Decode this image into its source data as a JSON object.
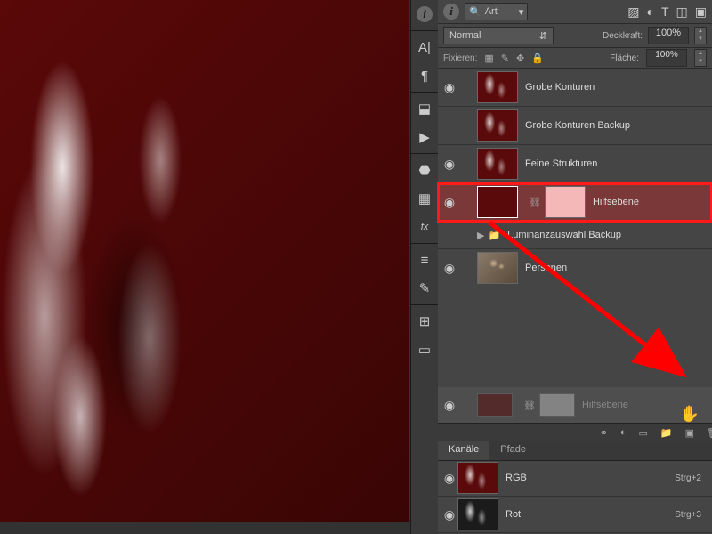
{
  "search": {
    "label": "Art"
  },
  "blend": {
    "mode": "Normal",
    "opacity_label": "Deckkraft:",
    "opacity": "100%",
    "fill_label": "Fläche:",
    "fill": "100%"
  },
  "lock": {
    "label": "Fixieren:"
  },
  "layers": [
    {
      "name": "Grobe Konturen",
      "vis": true,
      "type": "checker"
    },
    {
      "name": "Grobe Konturen Backup",
      "vis": false,
      "type": "checker"
    },
    {
      "name": "Feine Strukturen",
      "vis": true,
      "type": "checker"
    },
    {
      "name": "Hilfsebene",
      "vis": true,
      "type": "adjust",
      "selected": true
    },
    {
      "name": "Luminanzauswahl Backup",
      "vis": false,
      "type": "group"
    },
    {
      "name": "Personen",
      "vis": true,
      "type": "persons"
    }
  ],
  "ghost": {
    "name": "Hilfsebene"
  },
  "tabs": {
    "channels": "Kanäle",
    "paths": "Pfade"
  },
  "channels": [
    {
      "name": "RGB",
      "shortcut": "Strg+2"
    },
    {
      "name": "Rot",
      "shortcut": "Strg+3"
    }
  ]
}
